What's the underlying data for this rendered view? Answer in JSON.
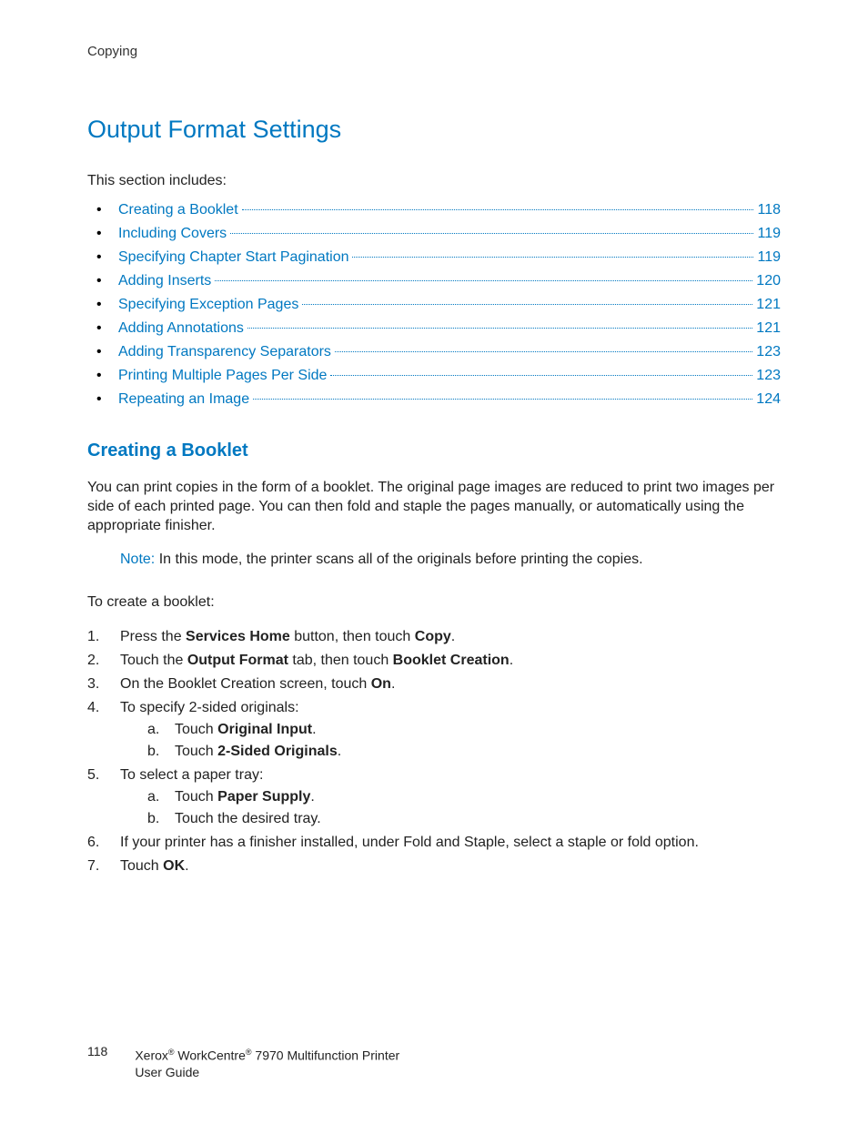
{
  "header": {
    "section": "Copying"
  },
  "title": "Output Format Settings",
  "intro": "This section includes:",
  "toc": [
    {
      "label": "Creating a Booklet",
      "page": "118"
    },
    {
      "label": "Including Covers",
      "page": "119"
    },
    {
      "label": "Specifying Chapter Start Pagination",
      "page": "119"
    },
    {
      "label": "Adding Inserts",
      "page": "120"
    },
    {
      "label": "Specifying Exception Pages",
      "page": "121"
    },
    {
      "label": "Adding Annotations",
      "page": "121"
    },
    {
      "label": "Adding Transparency Separators",
      "page": "123"
    },
    {
      "label": "Printing Multiple Pages Per Side",
      "page": "123"
    },
    {
      "label": "Repeating an Image",
      "page": "124"
    }
  ],
  "subheading": "Creating a Booklet",
  "para1": "You can print copies in the form of a booklet. The original page images are reduced to print two images per side of each printed page. You can then fold and staple the pages manually, or automatically using the appropriate finisher.",
  "note_label": "Note:",
  "note_text": " In this mode, the printer scans all of the originals before printing the copies.",
  "para2": "To create a booklet:",
  "steps": {
    "s1_a": "Press the ",
    "s1_b": "Services Home",
    "s1_c": " button, then touch ",
    "s1_d": "Copy",
    "s1_e": ".",
    "s2_a": "Touch the ",
    "s2_b": "Output Format",
    "s2_c": " tab, then touch ",
    "s2_d": "Booklet Creation",
    "s2_e": ".",
    "s3_a": "On the Booklet Creation screen, touch ",
    "s3_b": "On",
    "s3_c": ".",
    "s4": "To specify 2-sided originals:",
    "s4a_a": "Touch ",
    "s4a_b": "Original Input",
    "s4a_c": ".",
    "s4b_a": "Touch ",
    "s4b_b": "2-Sided Originals",
    "s4b_c": ".",
    "s5": "To select a paper tray:",
    "s5a_a": "Touch ",
    "s5a_b": "Paper Supply",
    "s5a_c": ".",
    "s5b": "Touch the desired tray.",
    "s6": "If your printer has a finisher installed, under Fold and Staple, select a staple or fold option.",
    "s7_a": "Touch ",
    "s7_b": "OK",
    "s7_c": "."
  },
  "footer": {
    "page": "118",
    "line1a": "Xerox",
    "line1b": " WorkCentre",
    "line1c": " 7970 Multifunction Printer",
    "line2": "User Guide"
  }
}
